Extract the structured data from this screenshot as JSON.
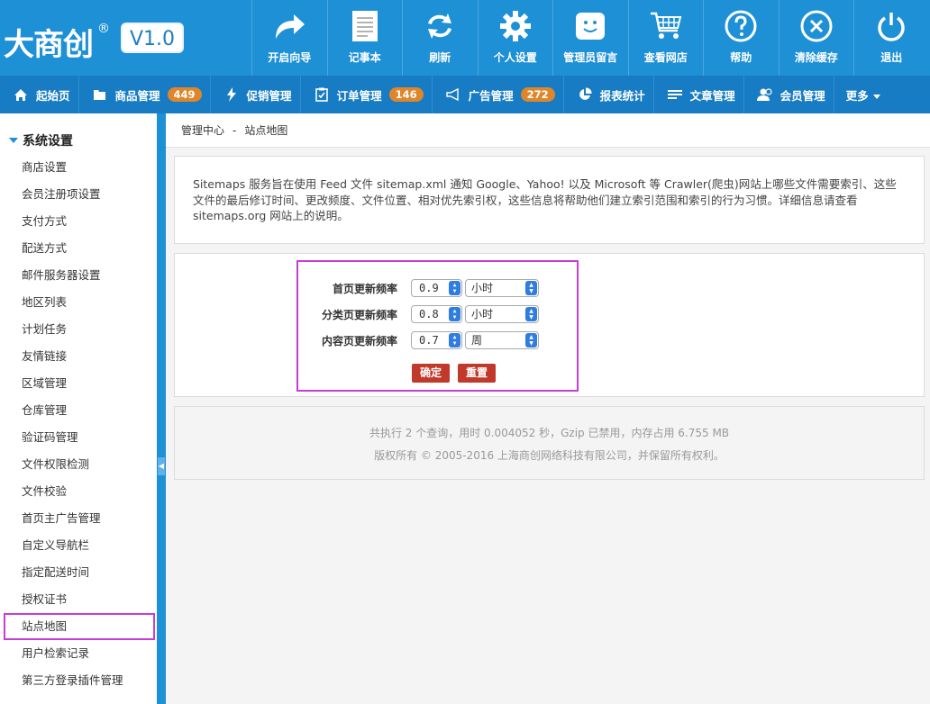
{
  "logo": {
    "text": "大商创",
    "registered": "®",
    "version": "V1.0"
  },
  "toolbar": [
    {
      "label": "开启向导",
      "icon": "share-arrow-icon"
    },
    {
      "label": "记事本",
      "icon": "notepad-icon"
    },
    {
      "label": "刷新",
      "icon": "refresh-icon"
    },
    {
      "label": "个人设置",
      "icon": "gear-icon"
    },
    {
      "label": "管理员留言",
      "icon": "smiley-message-icon"
    },
    {
      "label": "查看网店",
      "icon": "cart-icon"
    },
    {
      "label": "帮助",
      "icon": "question-icon"
    },
    {
      "label": "清除缓存",
      "icon": "clear-x-icon"
    },
    {
      "label": "退出",
      "icon": "power-icon"
    }
  ],
  "nav": [
    {
      "label": "起始页",
      "icon": "home-icon"
    },
    {
      "label": "商品管理",
      "icon": "folder-icon",
      "badge": "449"
    },
    {
      "label": "促销管理",
      "icon": "lightning-icon"
    },
    {
      "label": "订单管理",
      "icon": "clipboard-icon",
      "badge": "146"
    },
    {
      "label": "广告管理",
      "icon": "megaphone-icon",
      "badge": "272"
    },
    {
      "label": "报表统计",
      "icon": "pie-chart-icon"
    },
    {
      "label": "文章管理",
      "icon": "list-icon"
    },
    {
      "label": "会员管理",
      "icon": "users-icon"
    },
    {
      "label": "更多"
    }
  ],
  "sidebar": {
    "section": "系统设置",
    "items": [
      "商店设置",
      "会员注册项设置",
      "支付方式",
      "配送方式",
      "邮件服务器设置",
      "地区列表",
      "计划任务",
      "友情链接",
      "区域管理",
      "仓库管理",
      "验证码管理",
      "文件权限检测",
      "文件校验",
      "首页主广告管理",
      "自定义导航栏",
      "指定配送时间",
      "授权证书",
      "站点地图",
      "用户检索记录",
      "第三方登录插件管理"
    ],
    "active_index": 17
  },
  "breadcrumb": {
    "root": "管理中心",
    "sep": "-",
    "current": "站点地图"
  },
  "description": "Sitemaps 服务旨在使用 Feed 文件 sitemap.xml 通知 Google、Yahoo! 以及 Microsoft 等 Crawler(爬虫)网站上哪些文件需要索引、这些文件的最后修订时间、更改频度、文件位置、相对优先索引权，这些信息将帮助他们建立索引范围和索引的行为习惯。详细信息请查看 sitemaps.org 网站上的说明。",
  "form": {
    "rows": [
      {
        "label": "首页更新频率",
        "priority": "0.9",
        "frequency": "小时"
      },
      {
        "label": "分类页更新频率",
        "priority": "0.8",
        "frequency": "小时"
      },
      {
        "label": "内容页更新频率",
        "priority": "0.7",
        "frequency": "周"
      }
    ],
    "confirm": "确定",
    "reset": "重置"
  },
  "footer": {
    "line1": "共执行 2 个查询，用时 0.004052 秒，Gzip 已禁用，内存占用 6.755 MB",
    "line2": "版权所有 © 2005-2016 上海商创网络科技有限公司，并保留所有权利。"
  },
  "colors": {
    "header": "#1e90d6",
    "nav": "#177cc4",
    "badge": "#e0862a",
    "button": "#c1392b",
    "highlight": "#c63dd6"
  }
}
